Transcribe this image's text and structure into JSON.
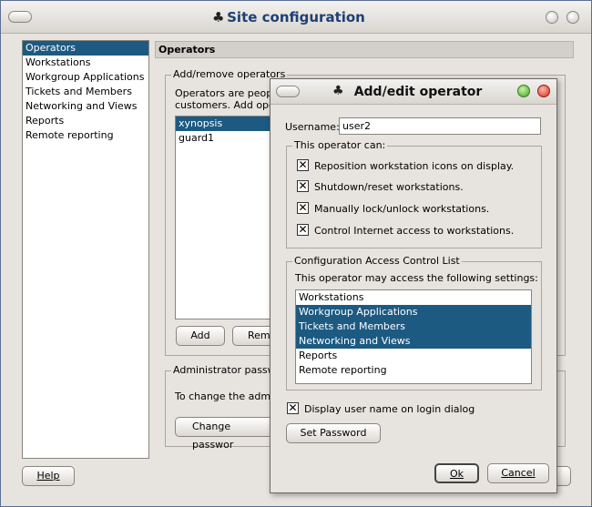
{
  "main": {
    "title": "Site configuration",
    "sidebar": [
      {
        "label": "Operators",
        "selected": true
      },
      {
        "label": "Workstations"
      },
      {
        "label": "Workgroup Applications"
      },
      {
        "label": "Tickets and Members"
      },
      {
        "label": "Networking and Views"
      },
      {
        "label": "Reports"
      },
      {
        "label": "Remote reporting"
      }
    ],
    "section_header": "Operators",
    "add_remove_group": "Add/remove operators",
    "desc_line1": "Operators are people",
    "desc_line2": "customers. Add oper",
    "operators": [
      {
        "name": "xynopsis",
        "selected": true
      },
      {
        "name": "guard1"
      }
    ],
    "add_button": "Add",
    "remove_button_partial": "Rem",
    "admin_group": "Administrator passw",
    "admin_desc": "To change the admini",
    "change_password_button": "Change passwor",
    "help_button": "Help"
  },
  "dialog": {
    "title": "Add/edit operator",
    "username_label": "Username:",
    "username_value": "user2",
    "can_group": "This operator can:",
    "permissions": [
      {
        "label": "Reposition workstation icons on display.",
        "checked": true
      },
      {
        "label": "Shutdown/reset workstations.",
        "checked": true
      },
      {
        "label": "Manually lock/unlock workstations.",
        "checked": true
      },
      {
        "label": "Control Internet access to workstations.",
        "checked": true
      }
    ],
    "acl_group": "Configuration Access Control List",
    "acl_desc": "This operator may access the following settings:",
    "acl_items": [
      {
        "label": "Workstations",
        "selected": false
      },
      {
        "label": "Workgroup Applications",
        "selected": true
      },
      {
        "label": "Tickets and Members",
        "selected": true
      },
      {
        "label": "Networking and Views",
        "selected": true
      },
      {
        "label": "Reports",
        "selected": false
      },
      {
        "label": "Remote reporting",
        "selected": false
      }
    ],
    "display_name_label": "Display user name on login dialog",
    "display_name_checked": true,
    "set_password_button": "Set Password",
    "ok_button": "Ok",
    "cancel_button": "Cancel"
  },
  "colors": {
    "selection": "#1c5a82",
    "window_bg": "#e7e3de",
    "title_text": "#1f3f73",
    "desktop": "#1c4f98"
  }
}
